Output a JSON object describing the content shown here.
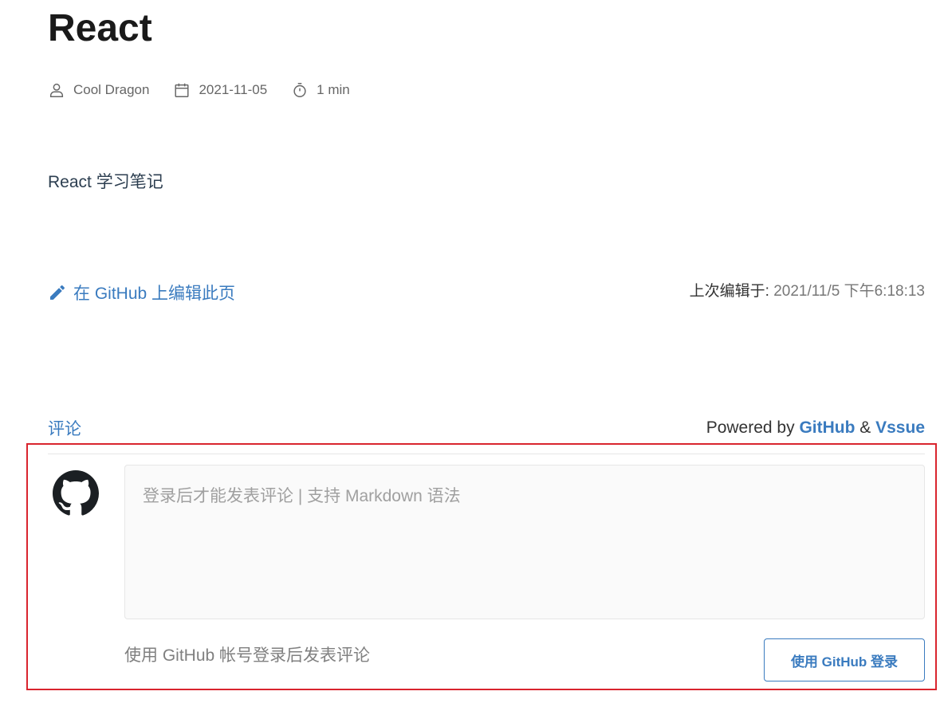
{
  "page": {
    "title": "React",
    "meta": {
      "author": "Cool Dragon",
      "author_icon": "user-icon",
      "date": "2021-11-05",
      "date_icon": "calendar-icon",
      "reading_time": "1 min",
      "reading_time_icon": "timer-icon"
    },
    "body": "React 学习笔记"
  },
  "footer": {
    "edit_link": "在 GitHub 上编辑此页",
    "edit_icon": "pencil-icon",
    "last_updated_label": "上次编辑于:",
    "last_updated_value": "2021/11/5 下午6:18:13"
  },
  "comments": {
    "title": "评论",
    "powered_by": "Powered by",
    "powered_github": "GitHub",
    "powered_and": "&",
    "powered_vssue": "Vssue",
    "avatar_icon": "github-icon",
    "input_placeholder": "登录后才能发表评论 | 支持 Markdown 语法",
    "login_hint": "使用 GitHub 帐号登录后发表评论",
    "login_button": "使用 GitHub 登录"
  },
  "colors": {
    "accent": "#3a7bbf",
    "highlight_border": "#d9242e",
    "text": "#2c3e50",
    "muted": "#808080"
  }
}
